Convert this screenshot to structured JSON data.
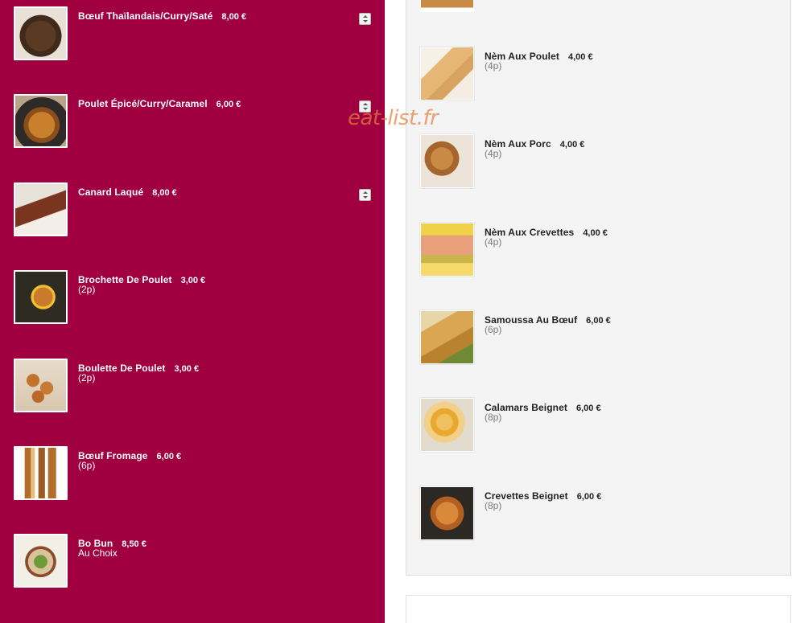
{
  "watermark": "eat-list.fr",
  "left_items": [
    {
      "name": "Bœuf Thaïlandais/Curry/Saté",
      "price": "8,00 €",
      "sub": "",
      "image": "beef-plate-photo",
      "stepper": true
    },
    {
      "name": "Poulet Épicé/Curry/Caramel",
      "price": "6,00 €",
      "sub": "",
      "image": "chicken-curry-photo",
      "stepper": true
    },
    {
      "name": "Canard Laqué",
      "price": "8,00 €",
      "sub": "",
      "image": "lacquered-duck-photo",
      "stepper": true
    },
    {
      "name": "Brochette De Poulet",
      "price": "3,00 €",
      "sub": "(2p)",
      "image": "chicken-skewer-photo",
      "stepper": false
    },
    {
      "name": "Boulette De Poulet",
      "price": "3,00 €",
      "sub": "(2p)",
      "image": "chicken-balls-photo",
      "stepper": false
    },
    {
      "name": "Bœuf Fromage",
      "price": "6,00 €",
      "sub": "(6p)",
      "image": "beef-cheese-photo",
      "stepper": false
    },
    {
      "name": "Bo Bun",
      "price": "8,50 €",
      "sub": "Au Choix",
      "image": "bo-bun-photo",
      "stepper": false
    }
  ],
  "right_items": [
    {
      "name": "Nèm Aux Poulet",
      "price": "4,00 €",
      "sub": "(4p)",
      "image": "chicken-nem-photo"
    },
    {
      "name": "Nèm Aux Porc",
      "price": "4,00 €",
      "sub": "(4p)",
      "image": "pork-nem-photo"
    },
    {
      "name": "Nèm Aux Crevettes",
      "price": "4,00 €",
      "sub": "(4p)",
      "image": "shrimp-nem-photo"
    },
    {
      "name": "Samoussa Au Bœuf",
      "price": "6,00 €",
      "sub": "(6p)",
      "image": "beef-samosa-photo"
    },
    {
      "name": "Calamars Beignet",
      "price": "6,00 €",
      "sub": "(8p)",
      "image": "calamari-fritter-photo"
    },
    {
      "name": "Crevettes Beignet",
      "price": "6,00 €",
      "sub": "(8p)",
      "image": "shrimp-fritter-photo"
    }
  ],
  "colors": {
    "left_panel_bg": "#a0003f",
    "right_panel_bg": "#f4f4f4",
    "watermark": "#e87e3c"
  }
}
